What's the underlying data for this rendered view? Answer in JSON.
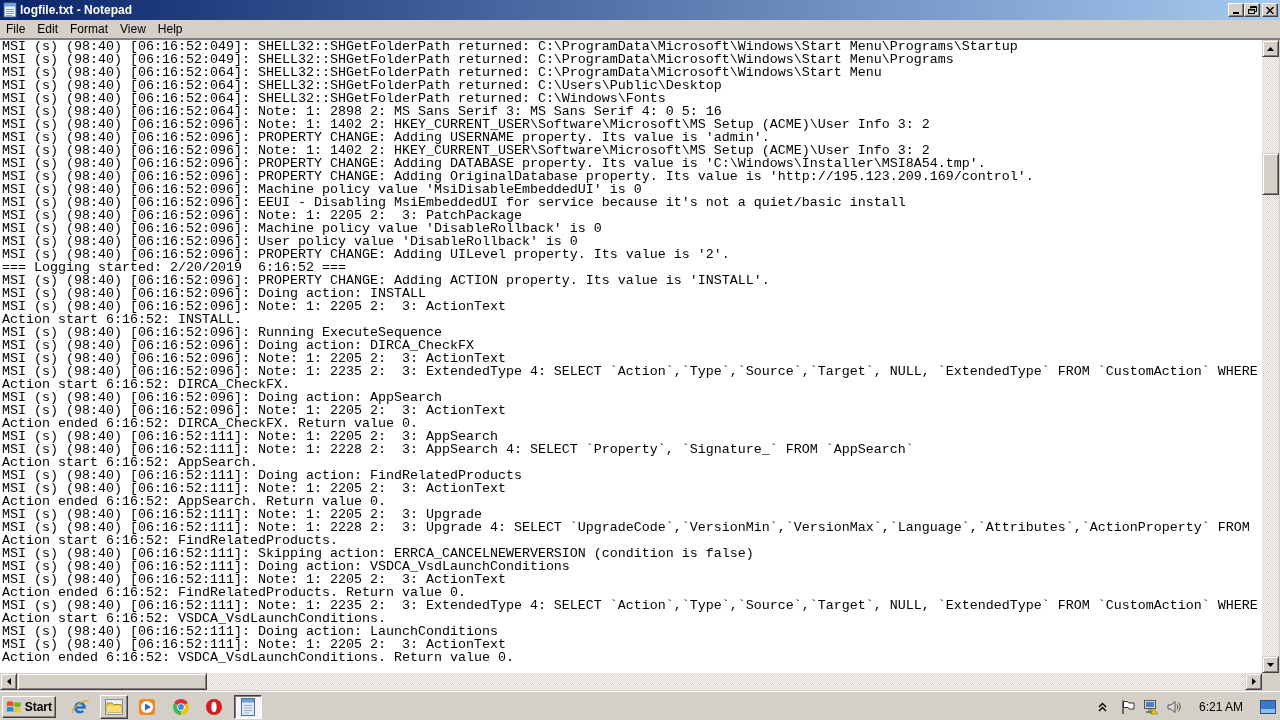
{
  "window": {
    "title": "logfile.txt - Notepad"
  },
  "menu": [
    "File",
    "Edit",
    "Format",
    "View",
    "Help"
  ],
  "editor": {
    "lines": [
      "MSI (s) (98:40) [06:16:52:049]: SHELL32::SHGetFolderPath returned: C:\\ProgramData\\Microsoft\\Windows\\Start Menu\\Programs\\Startup",
      "MSI (s) (98:40) [06:16:52:049]: SHELL32::SHGetFolderPath returned: C:\\ProgramData\\Microsoft\\Windows\\Start Menu\\Programs",
      "MSI (s) (98:40) [06:16:52:064]: SHELL32::SHGetFolderPath returned: C:\\ProgramData\\Microsoft\\Windows\\Start Menu",
      "MSI (s) (98:40) [06:16:52:064]: SHELL32::SHGetFolderPath returned: C:\\Users\\Public\\Desktop",
      "MSI (s) (98:40) [06:16:52:064]: SHELL32::SHGetFolderPath returned: C:\\Windows\\Fonts",
      "MSI (s) (98:40) [06:16:52:064]: Note: 1: 2898 2: MS Sans Serif 3: MS Sans Serif 4: 0 5: 16",
      "MSI (s) (98:40) [06:16:52:096]: Note: 1: 1402 2: HKEY_CURRENT_USER\\Software\\Microsoft\\MS Setup (ACME)\\User Info 3: 2",
      "MSI (s) (98:40) [06:16:52:096]: PROPERTY CHANGE: Adding USERNAME property. Its value is 'admin'.",
      "MSI (s) (98:40) [06:16:52:096]: Note: 1: 1402 2: HKEY_CURRENT_USER\\Software\\Microsoft\\MS Setup (ACME)\\User Info 3: 2",
      "MSI (s) (98:40) [06:16:52:096]: PROPERTY CHANGE: Adding DATABASE property. Its value is 'C:\\Windows\\Installer\\MSI8A54.tmp'.",
      "MSI (s) (98:40) [06:16:52:096]: PROPERTY CHANGE: Adding OriginalDatabase property. Its value is 'http://195.123.209.169/control'.",
      "MSI (s) (98:40) [06:16:52:096]: Machine policy value 'MsiDisableEmbeddedUI' is 0",
      "MSI (s) (98:40) [06:16:52:096]: EEUI - Disabling MsiEmbeddedUI for service because it's not a quiet/basic install",
      "MSI (s) (98:40) [06:16:52:096]: Note: 1: 2205 2:  3: PatchPackage",
      "MSI (s) (98:40) [06:16:52:096]: Machine policy value 'DisableRollback' is 0",
      "MSI (s) (98:40) [06:16:52:096]: User policy value 'DisableRollback' is 0",
      "MSI (s) (98:40) [06:16:52:096]: PROPERTY CHANGE: Adding UILevel property. Its value is '2'.",
      "=== Logging started: 2/20/2019  6:16:52 ===",
      "MSI (s) (98:40) [06:16:52:096]: PROPERTY CHANGE: Adding ACTION property. Its value is 'INSTALL'.",
      "MSI (s) (98:40) [06:16:52:096]: Doing action: INSTALL",
      "MSI (s) (98:40) [06:16:52:096]: Note: 1: 2205 2:  3: ActionText",
      "Action start 6:16:52: INSTALL.",
      "MSI (s) (98:40) [06:16:52:096]: Running ExecuteSequence",
      "MSI (s) (98:40) [06:16:52:096]: Doing action: DIRCA_CheckFX",
      "MSI (s) (98:40) [06:16:52:096]: Note: 1: 2205 2:  3: ActionText",
      "MSI (s) (98:40) [06:16:52:096]: Note: 1: 2235 2:  3: ExtendedType 4: SELECT `Action`,`Type`,`Source`,`Target`, NULL, `ExtendedType` FROM `CustomAction` WHERE",
      "Action start 6:16:52: DIRCA_CheckFX.",
      "MSI (s) (98:40) [06:16:52:096]: Doing action: AppSearch",
      "MSI (s) (98:40) [06:16:52:096]: Note: 1: 2205 2:  3: ActionText",
      "Action ended 6:16:52: DIRCA_CheckFX. Return value 0.",
      "MSI (s) (98:40) [06:16:52:111]: Note: 1: 2205 2:  3: AppSearch",
      "MSI (s) (98:40) [06:16:52:111]: Note: 1: 2228 2:  3: AppSearch 4: SELECT `Property`, `Signature_` FROM `AppSearch`",
      "Action start 6:16:52: AppSearch.",
      "MSI (s) (98:40) [06:16:52:111]: Doing action: FindRelatedProducts",
      "MSI (s) (98:40) [06:16:52:111]: Note: 1: 2205 2:  3: ActionText",
      "Action ended 6:16:52: AppSearch. Return value 0.",
      "MSI (s) (98:40) [06:16:52:111]: Note: 1: 2205 2:  3: Upgrade",
      "MSI (s) (98:40) [06:16:52:111]: Note: 1: 2228 2:  3: Upgrade 4: SELECT `UpgradeCode`,`VersionMin`,`VersionMax`,`Language`,`Attributes`,`ActionProperty` FROM",
      "Action start 6:16:52: FindRelatedProducts.",
      "MSI (s) (98:40) [06:16:52:111]: Skipping action: ERRCA_CANCELNEWERVERSION (condition is false)",
      "MSI (s) (98:40) [06:16:52:111]: Doing action: VSDCA_VsdLaunchConditions",
      "MSI (s) (98:40) [06:16:52:111]: Note: 1: 2205 2:  3: ActionText",
      "Action ended 6:16:52: FindRelatedProducts. Return value 0.",
      "MSI (s) (98:40) [06:16:52:111]: Note: 1: 2235 2:  3: ExtendedType 4: SELECT `Action`,`Type`,`Source`,`Target`, NULL, `ExtendedType` FROM `CustomAction` WHERE",
      "Action start 6:16:52: VSDCA_VsdLaunchConditions.",
      "MSI (s) (98:40) [06:16:52:111]: Doing action: LaunchConditions",
      "MSI (s) (98:40) [06:16:52:111]: Note: 1: 2205 2:  3: ActionText",
      "Action ended 6:16:52: VSDCA_VsdLaunchConditions. Return value 0."
    ]
  },
  "taskbar": {
    "start": "Start",
    "apps": [
      {
        "kind": "e-browser",
        "running": false,
        "selected": false
      },
      {
        "kind": "folder",
        "running": true,
        "selected": false
      },
      {
        "kind": "player",
        "running": false,
        "selected": false
      },
      {
        "kind": "wheel-browser",
        "running": false,
        "selected": false
      },
      {
        "kind": "ring-browser",
        "running": false,
        "selected": false
      },
      {
        "kind": "notepad",
        "running": true,
        "selected": true
      }
    ],
    "clock": "6:21 AM"
  }
}
